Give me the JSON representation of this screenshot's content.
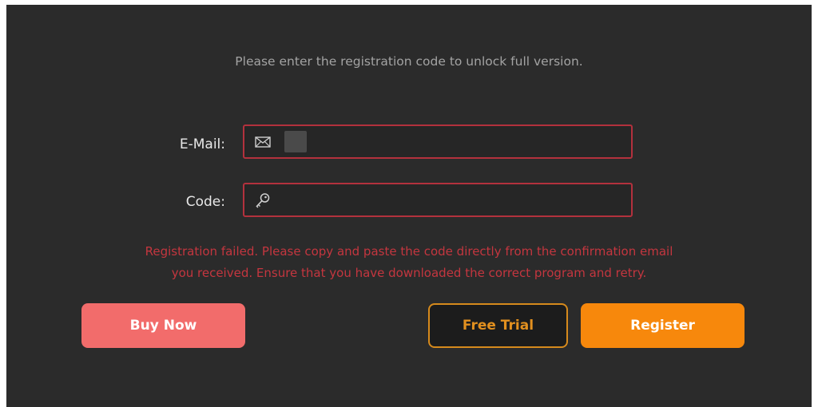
{
  "dialog": {
    "intro_text": "Please enter the registration code to unlock full version."
  },
  "form": {
    "email": {
      "label": "E-Mail:",
      "value": "",
      "placeholder": "",
      "icon": "envelope-icon"
    },
    "code": {
      "label": "Code:",
      "value": "",
      "placeholder": "",
      "icon": "key-icon"
    }
  },
  "error": {
    "line1": "Registration failed. Please copy and paste the code directly from the confirmation email",
    "line2": "you received. Ensure that you have downloaded the correct program and retry.",
    "color": "#c4363f"
  },
  "buttons": {
    "buy_now": "Buy Now",
    "free_trial": "Free Trial",
    "register": "Register"
  },
  "colors": {
    "background": "#2b2b2b",
    "field_border_error": "#b3313d",
    "buy_now": "#f26c6b",
    "register": "#f7880c",
    "free_trial_border": "#d68a1c"
  }
}
